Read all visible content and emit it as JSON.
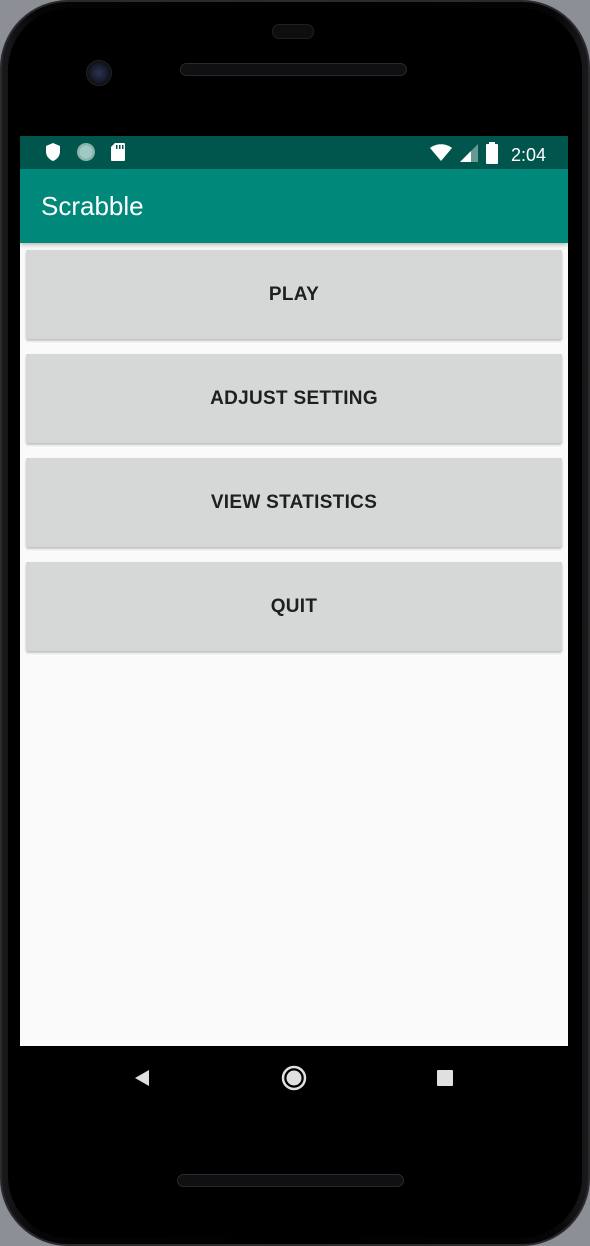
{
  "status_bar": {
    "time": "2:04",
    "left_icons": [
      "shield-icon",
      "circle-dot-icon",
      "sd-card-icon"
    ],
    "right_icons": [
      "wifi-icon",
      "cell-signal-icon",
      "battery-icon"
    ],
    "color": "#00564c"
  },
  "app_bar": {
    "title": "Scrabble",
    "color": "#00897b"
  },
  "menu": {
    "buttons": [
      {
        "label": "PLAY"
      },
      {
        "label": "ADJUST SETTING"
      },
      {
        "label": "VIEW STATISTICS"
      },
      {
        "label": "QUIT"
      }
    ],
    "button_color": "#d6d7d7"
  },
  "nav_bar": {
    "icons": [
      "back-icon",
      "home-icon",
      "recents-icon"
    ]
  }
}
